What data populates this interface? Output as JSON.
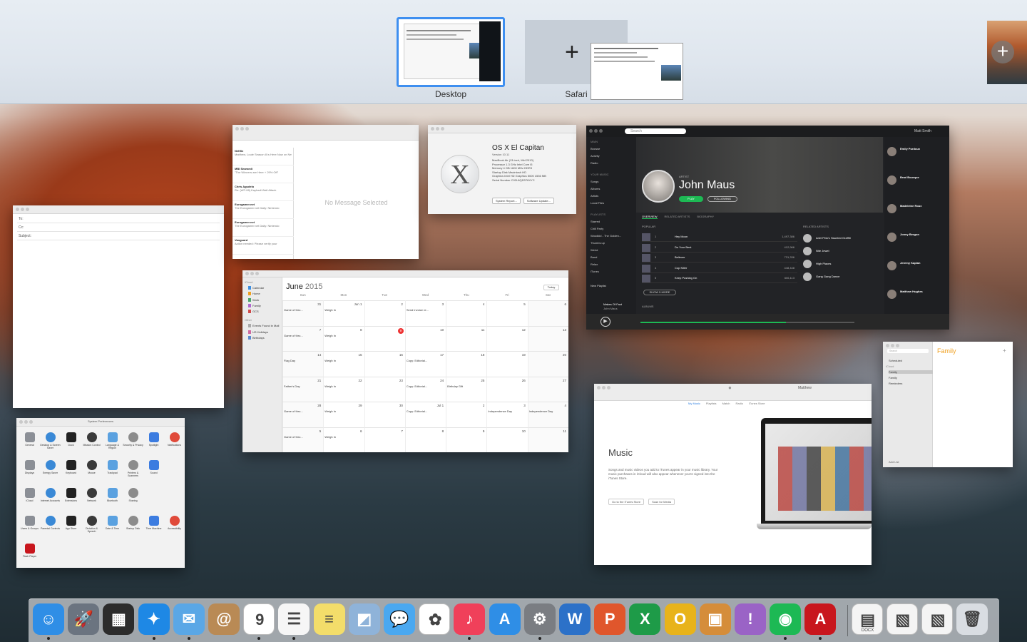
{
  "mission_control": {
    "spaces": [
      {
        "label": "Desktop",
        "selected": true
      },
      {
        "label": "Safari",
        "selected": false
      }
    ],
    "add_space_symbol": "+",
    "drop_symbol": "+"
  },
  "mail_compose": {
    "to": "To:",
    "cc": "Cc:",
    "subject": "Subject:"
  },
  "mail_viewer": {
    "empty_state": "No Message Selected",
    "messages": [
      {
        "from": "Netflix",
        "preview": "Matthew, Louie Season 8 is Here Now on Netflix"
      },
      {
        "from": "MBI Seamedi",
        "preview": "\"The Winners are Here + 29% Off\""
      },
      {
        "from": "Chris Agudelo",
        "preview": "Re: (WF-08) Kayhadi Wall Attack"
      },
      {
        "from": "Eurogamer.net",
        "preview": "The Eurogamer.net Daily: Nintendo"
      },
      {
        "from": "Eurogamer.net",
        "preview": "The Eurogamer.net Daily: Nintendo"
      },
      {
        "from": "Vanguard",
        "preview": "Action needed: Please verify your"
      }
    ]
  },
  "about_mac": {
    "title": "OS X El Capitan",
    "version": "Version 10.11",
    "specs": [
      "MacBook Air (13-inch, Mid 2013)",
      "Processor  1.3 GHz Intel Core i5",
      "Memory  4 GB 1600 MHz DDR3",
      "Startup Disk  Macintosh HD",
      "Graphics  Intel HD Graphics 5000 1536 MB",
      "Serial Number  C02L8Q1RF6XYC"
    ],
    "buttons": [
      "System Report...",
      "Software Update..."
    ],
    "logo_symbol": "X"
  },
  "calendar": {
    "title_month": "June",
    "title_year": "2015",
    "today_button": "Today",
    "weekdays": [
      "Sun",
      "Mon",
      "Tue",
      "Wed",
      "Thu",
      "Fri",
      "Sat"
    ],
    "sidebar": [
      "iCloud",
      "Calendar",
      "Home",
      "Work",
      "Family",
      "GCS",
      "Other",
      "Events Found in Mail",
      "US Holidays",
      "Birthdays"
    ],
    "weeks": [
      [
        "31",
        "Jun 1",
        "2",
        "3",
        "4",
        "5",
        "6"
      ],
      [
        "7",
        "8",
        "9",
        "10",
        "11",
        "12",
        "13"
      ],
      [
        "14",
        "15",
        "16",
        "17",
        "18",
        "19",
        "20"
      ],
      [
        "21",
        "22",
        "23",
        "24",
        "25",
        "26",
        "27"
      ],
      [
        "28",
        "29",
        "30",
        "Jul 1",
        "2",
        "3",
        "4"
      ],
      [
        "5",
        "6",
        "7",
        "8",
        "9",
        "10",
        "11"
      ]
    ],
    "today_date": "9",
    "events": [
      {
        "week": 0,
        "day": 0,
        "text": "Game of thro..."
      },
      {
        "week": 0,
        "day": 1,
        "text": "Weigh In"
      },
      {
        "week": 0,
        "day": 3,
        "text": "Send Invoice re..."
      },
      {
        "week": 1,
        "day": 0,
        "text": "Game of thro..."
      },
      {
        "week": 1,
        "day": 1,
        "text": "Weigh In"
      },
      {
        "week": 2,
        "day": 0,
        "text": "Flag Day"
      },
      {
        "week": 2,
        "day": 1,
        "text": "Weigh In"
      },
      {
        "week": 2,
        "day": 3,
        "text": "Copy: Editorial..."
      },
      {
        "week": 3,
        "day": 0,
        "text": "Father's Day"
      },
      {
        "week": 3,
        "day": 1,
        "text": "Weigh In"
      },
      {
        "week": 3,
        "day": 3,
        "text": "Copy: Editorial..."
      },
      {
        "week": 3,
        "day": 4,
        "text": "Birthday Gift"
      },
      {
        "week": 4,
        "day": 0,
        "text": "Game of thro..."
      },
      {
        "week": 4,
        "day": 1,
        "text": "Weigh In"
      },
      {
        "week": 4,
        "day": 3,
        "text": "Copy: Editorial..."
      },
      {
        "week": 4,
        "day": 5,
        "text": "Independence Day"
      },
      {
        "week": 4,
        "day": 6,
        "text": "Independence Day"
      },
      {
        "week": 5,
        "day": 0,
        "text": "Game of thro..."
      },
      {
        "week": 5,
        "day": 1,
        "text": "Weigh In"
      }
    ]
  },
  "spotify": {
    "search_placeholder": "Search",
    "user": "Matt Smith",
    "artist_label": "ARTIST",
    "artist": "John Maus",
    "play": "PLAY",
    "following": "FOLLOWING",
    "tabs": [
      "OVERVIEW",
      "RELATED ARTISTS",
      "BIOGRAPHY"
    ],
    "popular_label": "POPULAR",
    "tracks": [
      {
        "n": "1",
        "title": "Hey Moon",
        "plays": "1,497,386"
      },
      {
        "n": "2",
        "title": "Do Your Best",
        "plays": "412,966"
      },
      {
        "n": "3",
        "title": "Believer",
        "plays": "731,336"
      },
      {
        "n": "4",
        "title": "Cop Killer",
        "plays": "448,448"
      },
      {
        "n": "5",
        "title": "Keep Pushing On",
        "plays": "606,113"
      }
    ],
    "show_more": "SHOW 5 MORE",
    "related_label": "RELATED ARTISTS",
    "related": [
      "Ariel Pink's Haunted Graffiti",
      "Nite Jewel",
      "High Places",
      "Gang Gang Dance"
    ],
    "albums_label": "ALBUMS",
    "sidebar_main": [
      "MAIN",
      "Browse",
      "Activity",
      "Radio"
    ],
    "sidebar_music": [
      "YOUR MUSIC",
      "Songs",
      "Albums",
      "Artists",
      "Local Files"
    ],
    "sidebar_playlists": [
      "PLAYLISTS",
      "Starred",
      "Chill Party",
      "Woodkid - The Golden...",
      "Thumbs up",
      "Weird",
      "Band",
      "Relax",
      "iTunes"
    ],
    "new_playlist": "New Playlist",
    "now_playing": "Makes Of Fact",
    "now_playing_artist": "John Maus",
    "friends": [
      "Emily Purdoux",
      "Brad Bourque",
      "Madeleine Roux",
      "Jonny Bergon",
      "Jeremy Kaplan",
      "Matthew Hughes"
    ]
  },
  "itunes": {
    "user": "Matthew",
    "tabs": [
      "My Music",
      "Playlists",
      "Match",
      "Radio",
      "iTunes Store"
    ],
    "title": "Music",
    "body": "Songs and music videos you add to iTunes appear in your music library. Your music purchases in iCloud will also appear whenever you're signed into the iTunes Store.",
    "buttons": [
      "Go to the iTunes Store",
      "Scan for Media"
    ],
    "apple_symbol": "●"
  },
  "reminders": {
    "list_title": "Family",
    "search": "Search",
    "scheduled": "Scheduled",
    "sidebar": [
      "iCloud",
      "Family",
      "Family",
      "Reminders"
    ],
    "add_list": "Add List"
  },
  "system_prefs": {
    "title": "System Preferences",
    "rows": [
      [
        "General",
        "Desktop & Screen Saver",
        "Dock",
        "Mission Control",
        "Language & Region",
        "Security & Privacy",
        "Spotlight",
        "Notifications"
      ],
      [
        "Displays",
        "Energy Saver",
        "Keyboard",
        "Mouse",
        "Trackpad",
        "Printers & Scanners",
        "Sound"
      ],
      [
        "iCloud",
        "Internet Accounts",
        "Extensions",
        "Network",
        "Bluetooth",
        "Sharing"
      ],
      [
        "Users & Groups",
        "Parental Controls",
        "App Store",
        "Dictation & Speech",
        "Date & Time",
        "Startup Disk",
        "Time Machine",
        "Accessibility"
      ],
      [
        "Flash Player"
      ]
    ],
    "colors": [
      "#8b8f96",
      "#3a89d6",
      "#222",
      "#3a3a3a",
      "#5aa1e0",
      "#8c8c8c",
      "#3c7ce0",
      "#e04a3a"
    ]
  },
  "dock": {
    "items": [
      {
        "name": "finder-icon",
        "color": "#2f8ee6",
        "glyph": "☺",
        "running": true
      },
      {
        "name": "launchpad-icon",
        "color": "#6b7480",
        "glyph": "🚀",
        "running": false
      },
      {
        "name": "mission-control-icon",
        "color": "#2c2c2c",
        "glyph": "▦",
        "running": false
      },
      {
        "name": "safari-icon",
        "color": "#1e88e5",
        "glyph": "✦",
        "running": true
      },
      {
        "name": "mail-icon",
        "color": "#5aa7e6",
        "glyph": "✉",
        "running": true
      },
      {
        "name": "contacts-icon",
        "color": "#b98a55",
        "glyph": "@",
        "running": false
      },
      {
        "name": "calendar-icon",
        "color": "#ffffff",
        "glyph": "9",
        "running": true
      },
      {
        "name": "reminders-icon",
        "color": "#f6f6f6",
        "glyph": "☰",
        "running": true
      },
      {
        "name": "notes-icon",
        "color": "#f3dd6a",
        "glyph": "≡",
        "running": false
      },
      {
        "name": "preview-icon",
        "color": "#8fb3d9",
        "glyph": "◩",
        "running": false
      },
      {
        "name": "messages-icon",
        "color": "#4aa8f0",
        "glyph": "💬",
        "running": false
      },
      {
        "name": "photos-icon",
        "color": "#ffffff",
        "glyph": "✿",
        "running": false
      },
      {
        "name": "itunes-icon",
        "color": "#f0405a",
        "glyph": "♪",
        "running": true
      },
      {
        "name": "app-store-icon",
        "color": "#2f8ee6",
        "glyph": "A",
        "running": false
      },
      {
        "name": "system-preferences-icon",
        "color": "#7a7d82",
        "glyph": "⚙",
        "running": true
      },
      {
        "name": "word-icon",
        "color": "#2c71c8",
        "glyph": "W",
        "running": false
      },
      {
        "name": "powerpoint-icon",
        "color": "#e0562c",
        "glyph": "P",
        "running": false
      },
      {
        "name": "excel-icon",
        "color": "#1e9b48",
        "glyph": "X",
        "running": false
      },
      {
        "name": "outlook-icon",
        "color": "#e8b31a",
        "glyph": "O",
        "running": false
      },
      {
        "name": "iphoto-icon",
        "color": "#d58d3a",
        "glyph": "▣",
        "running": false
      },
      {
        "name": "feedback-icon",
        "color": "#9a63c6",
        "glyph": "!",
        "running": false
      },
      {
        "name": "spotify-icon",
        "color": "#1db954",
        "glyph": "◉",
        "running": true
      },
      {
        "name": "acrobat-icon",
        "color": "#c8161d",
        "glyph": "A",
        "running": true
      },
      {
        "name": "docx-file-icon",
        "color": "#f4f4f4",
        "glyph": "▤",
        "running": false
      },
      {
        "name": "screenshot-file-icon",
        "color": "#f4f4f4",
        "glyph": "▧",
        "running": false
      },
      {
        "name": "screenshot-file-icon-2",
        "color": "#f4f4f4",
        "glyph": "▧",
        "running": false
      },
      {
        "name": "trash-icon",
        "color": "#d9dde2",
        "glyph": "🗑",
        "running": false
      }
    ],
    "file_caption": "DOCX"
  }
}
